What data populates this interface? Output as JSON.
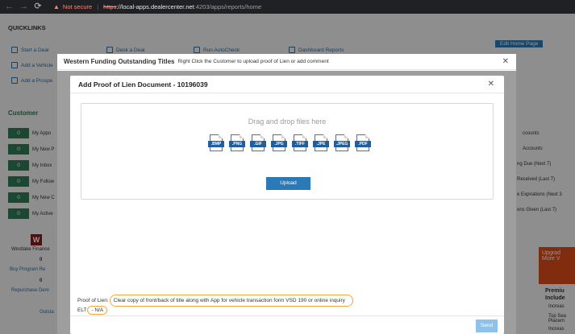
{
  "browser": {
    "security_label": "Not secure",
    "scheme": "https",
    "scheme_suffix": "://",
    "host": "local-apps.dealercenter.net",
    "path": ":4203/apps/reports/home"
  },
  "background": {
    "quicklinks_title": "QUICKLINKS",
    "quicklinks": [
      "Start a Deal",
      "Add a Vehicle",
      "Add a Prospe",
      "Desk a Deal",
      "Run AutoCheck",
      "Dashboard Reports",
      "Edit Home Page"
    ],
    "customer_title": "Customer",
    "customer_rows": [
      {
        "count": "0",
        "label": "My Appo"
      },
      {
        "count": "0",
        "label": "My New P"
      },
      {
        "count": "0",
        "label": "My Inbox"
      },
      {
        "count": "0",
        "label": "My Follow"
      },
      {
        "count": "0",
        "label": "My New C"
      },
      {
        "count": "0",
        "label": "My Active"
      }
    ],
    "right_items": [
      "ccounts",
      "Accounts",
      "ng Due (Next 7)",
      "Received (Last 7)",
      "e Expirations (Next 3",
      "ons Given (Last 7)"
    ],
    "westlake_name": "Westlake Finance",
    "buy_program_count": "0",
    "buy_program_label": "Buy Program Re",
    "repurchase_count": "0",
    "repurchase_label": "Repurchase Dem",
    "outstanding_label": "Outsta",
    "promo_text": "Upgrad More V",
    "premium_text": "Premiu Include",
    "premium_items": [
      "Increas",
      "Top Sea Placem",
      "Increas"
    ]
  },
  "outer_modal": {
    "title": "Western Funding Outstanding Titles",
    "subtitle": "Right Click the Customer to upload proof of Lien or add comment"
  },
  "inner_modal": {
    "title": "Add Proof of Lien Document - 10196039",
    "dropzone_text": "Drag and drop files here",
    "file_types": [
      ".BMP",
      ".PNG",
      ".GIF",
      ".JPG",
      ".TIFF",
      ".JPE",
      ".JPEG",
      ".PDF"
    ],
    "upload_label": "Upload",
    "proof_of_lien_label": "Proof of Lien:",
    "proof_of_lien_value": "Clear copy of front/back of title along with App for vehicle transaction form VSD 190 or online inquiry",
    "elt_label": "ELT",
    "elt_value": "- N/A",
    "send_label": "Send"
  },
  "colors": {
    "highlight": "#f2a93b",
    "primary_button": "#2a7ab8",
    "disabled_button": "#8ec2ea",
    "customer_green": "#2e7d57"
  }
}
